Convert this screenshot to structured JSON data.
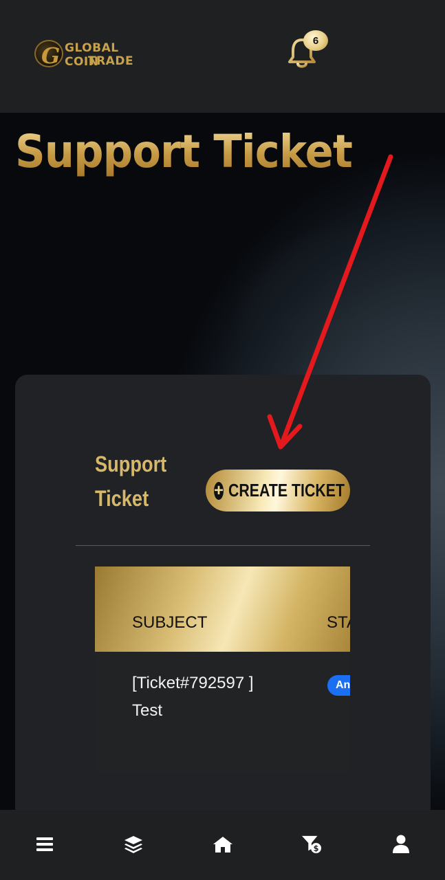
{
  "header": {
    "logo_text_line1": "GLOBAL COIN",
    "logo_text_line2": "TRADE",
    "logo_initial": "G",
    "notification_count": "6"
  },
  "page": {
    "title": "Support Ticket"
  },
  "card": {
    "heading": "Support Ticket",
    "create_button_label": "CREATE TICKET",
    "table": {
      "columns": [
        "SUBJECT",
        "STATUS"
      ],
      "rows": [
        {
          "subject": "[Ticket#792597 ] Test",
          "status": "Answered"
        }
      ]
    }
  },
  "bottom_nav": {
    "items": [
      "menu-icon",
      "layers-icon",
      "home-icon",
      "funnel-dollar-icon",
      "user-icon"
    ]
  },
  "colors": {
    "gold": "#d6b86a",
    "background_dark": "#1f2022",
    "card": "#202225",
    "annotation_arrow": "#e3191d",
    "status_blue": "#1a6ff2"
  }
}
